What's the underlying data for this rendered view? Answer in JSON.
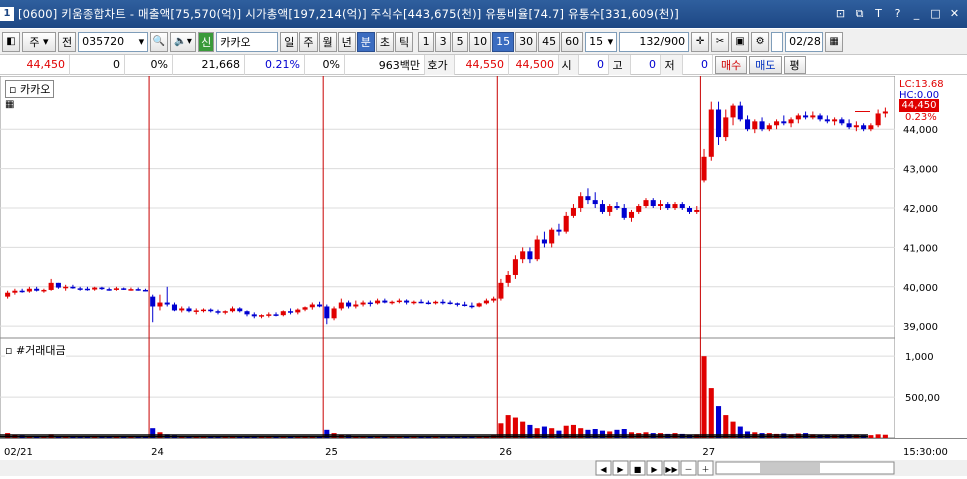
{
  "window": {
    "number": "1",
    "title": "[0600] 키움종합차트 - 매출액[75,570(억)] 시가총액[197,214(억)] 주식수[443,675(천)] 유통비율[74.7] 유통수[331,609(천)]"
  },
  "toolbar": {
    "market": "주",
    "market_alt": "전",
    "code": "035720",
    "stock_name": "카카오",
    "stock_badge": "신",
    "periods": [
      "일",
      "주",
      "월",
      "년",
      "분",
      "초",
      "틱"
    ],
    "minutes": [
      "1",
      "3",
      "5",
      "10",
      "15",
      "30",
      "45",
      "60"
    ],
    "selected_period": "분",
    "selected_minute": "15",
    "interval": "15",
    "count": "132",
    "count_max": "/900",
    "date": "02/28"
  },
  "quote": {
    "price": "44,450",
    "change": "0",
    "change_pct": "0%",
    "volume": "21,668",
    "volume_pct": "0.21%",
    "pct2": "0%",
    "amount": "963백만",
    "hoga_label": "호가",
    "ask": "44,550",
    "bid": "44,500",
    "open_label": "시",
    "open": "0",
    "high_label": "고",
    "high": "0",
    "low_label": "저",
    "low": "0",
    "buy": "매수",
    "sell": "매도",
    "eval": "평"
  },
  "chart_panel": {
    "name": "카카오",
    "lc": "LC:13.68",
    "hc": "HC:0.00",
    "current": "44,450",
    "current_pct": "0.23%"
  },
  "volume_panel": {
    "name": "#거래대금"
  },
  "price_axis": [
    "44,000",
    "43,000",
    "42,000",
    "41,000",
    "40,000",
    "39,000"
  ],
  "volume_axis": [
    "1,000",
    "500,00"
  ],
  "date_axis": [
    "02/21",
    "24",
    "25",
    "26",
    "27"
  ],
  "time_label": "15:30:00",
  "colors": {
    "up": "#e00000",
    "down": "#0000d0",
    "divider": "#c80000",
    "grid": "#dcdcdc",
    "current": "#e00000"
  },
  "chart_data": {
    "type": "candlestick",
    "ylim": [
      38700,
      45300
    ],
    "x_ticks": [
      "02/21",
      "24",
      "25",
      "26",
      "27"
    ],
    "days": [
      {
        "label": "02/21",
        "ohlc": [
          [
            39750,
            39900,
            39700,
            39850
          ],
          [
            39850,
            39950,
            39800,
            39900
          ],
          [
            39900,
            39950,
            39850,
            39880
          ],
          [
            39880,
            40000,
            39850,
            39950
          ],
          [
            39950,
            40000,
            39880,
            39900
          ],
          [
            39900,
            39950,
            39850,
            39920
          ],
          [
            39920,
            40200,
            39900,
            40100
          ],
          [
            40100,
            40100,
            39950,
            39980
          ],
          [
            39980,
            40050,
            39900,
            40000
          ],
          [
            40000,
            40050,
            39950,
            39960
          ],
          [
            39960,
            40000,
            39900,
            39950
          ],
          [
            39950,
            40000,
            39900,
            39930
          ],
          [
            39930,
            40000,
            39900,
            39980
          ],
          [
            39980,
            40000,
            39920,
            39940
          ],
          [
            39940,
            39980,
            39900,
            39920
          ],
          [
            39920,
            40000,
            39900,
            39960
          ],
          [
            39960,
            39980,
            39920,
            39930
          ],
          [
            39930,
            39980,
            39900,
            39940
          ],
          [
            39940,
            39980,
            39900,
            39920
          ],
          [
            39920,
            39950,
            39880,
            39900
          ]
        ]
      },
      {
        "label": "24",
        "ohlc": [
          [
            39750,
            39800,
            39100,
            39500
          ],
          [
            39500,
            39800,
            39400,
            39600
          ],
          [
            39600,
            40000,
            39500,
            39550
          ],
          [
            39550,
            39600,
            39380,
            39400
          ],
          [
            39400,
            39500,
            39350,
            39450
          ],
          [
            39450,
            39500,
            39350,
            39380
          ],
          [
            39380,
            39450,
            39300,
            39400
          ],
          [
            39400,
            39450,
            39350,
            39420
          ],
          [
            39420,
            39450,
            39350,
            39380
          ],
          [
            39380,
            39420,
            39300,
            39350
          ],
          [
            39350,
            39400,
            39300,
            39380
          ],
          [
            39380,
            39500,
            39350,
            39450
          ],
          [
            39450,
            39480,
            39350,
            39380
          ],
          [
            39380,
            39400,
            39250,
            39300
          ],
          [
            39300,
            39350,
            39200,
            39250
          ],
          [
            39250,
            39300,
            39200,
            39280
          ],
          [
            39280,
            39350,
            39220,
            39300
          ],
          [
            39300,
            39350,
            39250,
            39280
          ],
          [
            39280,
            39400,
            39250,
            39380
          ],
          [
            39380,
            39450,
            39300,
            39350
          ],
          [
            39350,
            39450,
            39300,
            39420
          ],
          [
            39420,
            39500,
            39380,
            39480
          ],
          [
            39480,
            39600,
            39420,
            39550
          ],
          [
            39550,
            39620,
            39480,
            39500
          ]
        ]
      },
      {
        "label": "25",
        "ohlc": [
          [
            39500,
            39550,
            39050,
            39200
          ],
          [
            39200,
            39500,
            39150,
            39450
          ],
          [
            39450,
            39700,
            39400,
            39600
          ],
          [
            39600,
            39650,
            39450,
            39500
          ],
          [
            39500,
            39650,
            39450,
            39550
          ],
          [
            39550,
            39650,
            39500,
            39600
          ],
          [
            39600,
            39650,
            39500,
            39580
          ],
          [
            39580,
            39700,
            39550,
            39650
          ],
          [
            39650,
            39700,
            39580,
            39600
          ],
          [
            39600,
            39650,
            39550,
            39620
          ],
          [
            39620,
            39700,
            39580,
            39650
          ],
          [
            39650,
            39680,
            39550,
            39600
          ],
          [
            39600,
            39650,
            39550,
            39620
          ],
          [
            39620,
            39680,
            39580,
            39600
          ],
          [
            39600,
            39650,
            39550,
            39580
          ],
          [
            39580,
            39650,
            39550,
            39620
          ],
          [
            39620,
            39680,
            39550,
            39600
          ],
          [
            39600,
            39650,
            39550,
            39580
          ],
          [
            39580,
            39600,
            39500,
            39550
          ],
          [
            39550,
            39620,
            39500,
            39520
          ],
          [
            39520,
            39600,
            39450,
            39500
          ],
          [
            39500,
            39600,
            39480,
            39580
          ],
          [
            39580,
            39700,
            39550,
            39650
          ],
          [
            39650,
            39750,
            39600,
            39700
          ]
        ]
      },
      {
        "label": "26",
        "ohlc": [
          [
            39700,
            40200,
            39650,
            40100
          ],
          [
            40100,
            40400,
            40000,
            40300
          ],
          [
            40300,
            40800,
            40200,
            40700
          ],
          [
            40700,
            41000,
            40600,
            40900
          ],
          [
            40900,
            41000,
            40600,
            40700
          ],
          [
            40700,
            41300,
            40650,
            41200
          ],
          [
            41200,
            41400,
            41000,
            41100
          ],
          [
            41100,
            41500,
            41000,
            41450
          ],
          [
            41450,
            41600,
            41300,
            41400
          ],
          [
            41400,
            41900,
            41350,
            41800
          ],
          [
            41800,
            42100,
            41750,
            42000
          ],
          [
            42000,
            42400,
            41900,
            42300
          ],
          [
            42300,
            42500,
            42100,
            42200
          ],
          [
            42200,
            42400,
            42000,
            42100
          ],
          [
            42100,
            42200,
            41850,
            41900
          ],
          [
            41900,
            42100,
            41800,
            42050
          ],
          [
            42050,
            42150,
            41950,
            42000
          ],
          [
            42000,
            42100,
            41700,
            41750
          ],
          [
            41750,
            41950,
            41650,
            41900
          ],
          [
            41900,
            42100,
            41850,
            42050
          ],
          [
            42050,
            42250,
            42000,
            42200
          ],
          [
            42200,
            42250,
            42000,
            42050
          ],
          [
            42050,
            42200,
            41950,
            42100
          ],
          [
            42100,
            42150,
            41950,
            42000
          ],
          [
            42000,
            42150,
            41950,
            42100
          ],
          [
            42100,
            42150,
            41950,
            42000
          ],
          [
            42000,
            42050,
            41850,
            41900
          ],
          [
            41900,
            42050,
            41850,
            41950
          ]
        ]
      },
      {
        "label": "27",
        "ohlc": [
          [
            42700,
            43500,
            42650,
            43300
          ],
          [
            43300,
            44700,
            43200,
            44500
          ],
          [
            44500,
            44700,
            43600,
            43800
          ],
          [
            43800,
            44500,
            43700,
            44300
          ],
          [
            44300,
            44650,
            44100,
            44600
          ],
          [
            44600,
            44700,
            44200,
            44250
          ],
          [
            44250,
            44350,
            43950,
            44000
          ],
          [
            44000,
            44250,
            43900,
            44200
          ],
          [
            44200,
            44300,
            43950,
            44000
          ],
          [
            44000,
            44150,
            43950,
            44100
          ],
          [
            44100,
            44250,
            44000,
            44200
          ],
          [
            44200,
            44350,
            44100,
            44150
          ],
          [
            44150,
            44300,
            44050,
            44250
          ],
          [
            44250,
            44400,
            44150,
            44350
          ],
          [
            44350,
            44450,
            44250,
            44300
          ],
          [
            44300,
            44450,
            44250,
            44350
          ],
          [
            44350,
            44400,
            44200,
            44250
          ],
          [
            44250,
            44350,
            44150,
            44200
          ],
          [
            44200,
            44300,
            44100,
            44250
          ],
          [
            44250,
            44300,
            44100,
            44150
          ],
          [
            44150,
            44250,
            44000,
            44050
          ],
          [
            44050,
            44200,
            43950,
            44100
          ],
          [
            44100,
            44150,
            43950,
            44000
          ],
          [
            44000,
            44150,
            43950,
            44100
          ],
          [
            44100,
            44500,
            44050,
            44400
          ],
          [
            44400,
            44550,
            44300,
            44450
          ]
        ]
      }
    ],
    "volume_series": {
      "name": "#거래대금",
      "ylim": [
        0,
        1100
      ],
      "values": [
        [
          60,
          40,
          35,
          25,
          20,
          18,
          45,
          28,
          22,
          20,
          18,
          16,
          20,
          18,
          15,
          18,
          16,
          15,
          14,
          18
        ],
        [
          120,
          70,
          45,
          35,
          30,
          28,
          25,
          22,
          20,
          18,
          16,
          18,
          15,
          22,
          20,
          18,
          16,
          16,
          18,
          20,
          22,
          20,
          24,
          22
        ],
        [
          100,
          60,
          40,
          35,
          30,
          28,
          26,
          24,
          22,
          20,
          22,
          20,
          18,
          18,
          16,
          18,
          18,
          16,
          16,
          16,
          16,
          18,
          30,
          35
        ],
        [
          180,
          280,
          250,
          200,
          160,
          120,
          140,
          120,
          90,
          150,
          160,
          120,
          100,
          110,
          90,
          80,
          100,
          110,
          70,
          60,
          70,
          60,
          60,
          50,
          60,
          50,
          40,
          45
        ],
        [
          1000,
          610,
          390,
          280,
          200,
          140,
          80,
          70,
          60,
          60,
          50,
          55,
          45,
          55,
          60,
          45,
          40,
          40,
          35,
          40,
          45,
          40,
          35,
          35,
          45,
          40
        ]
      ]
    }
  }
}
